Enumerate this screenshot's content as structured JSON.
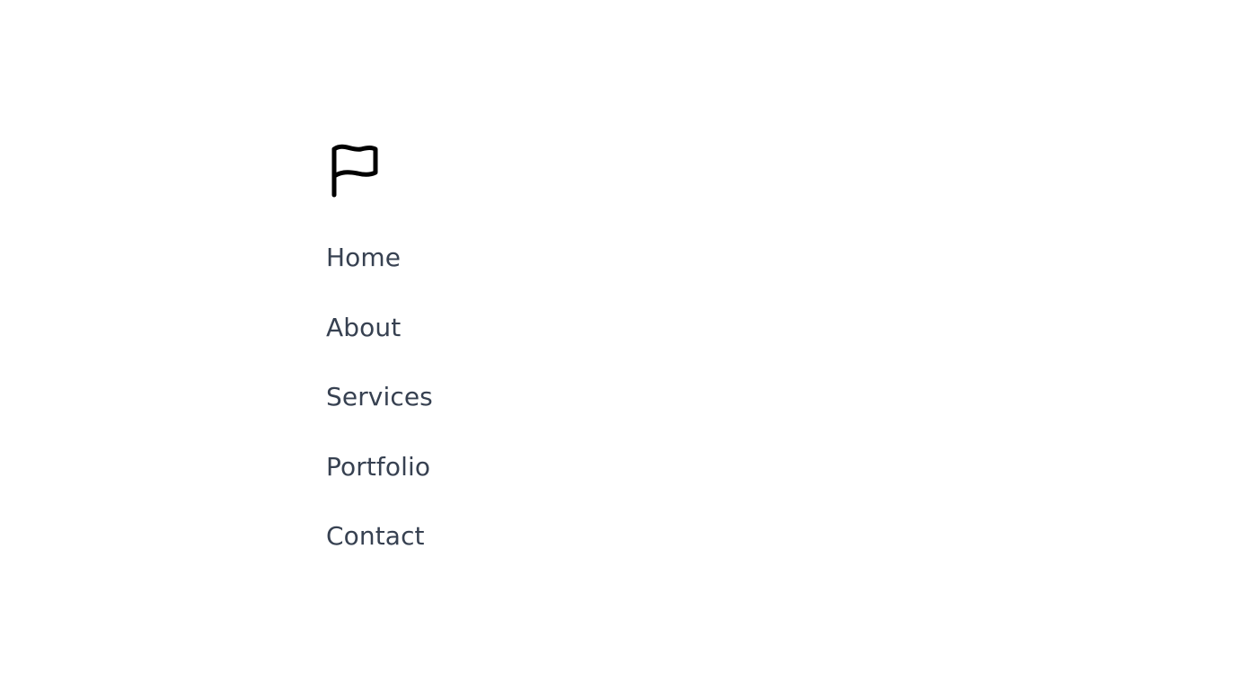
{
  "logo": {
    "icon": "flag-icon",
    "color": "#000000"
  },
  "nav": {
    "text_color": "#374151",
    "items": [
      {
        "label": "Home"
      },
      {
        "label": "About"
      },
      {
        "label": "Services"
      },
      {
        "label": "Portfolio"
      },
      {
        "label": "Contact"
      }
    ]
  }
}
